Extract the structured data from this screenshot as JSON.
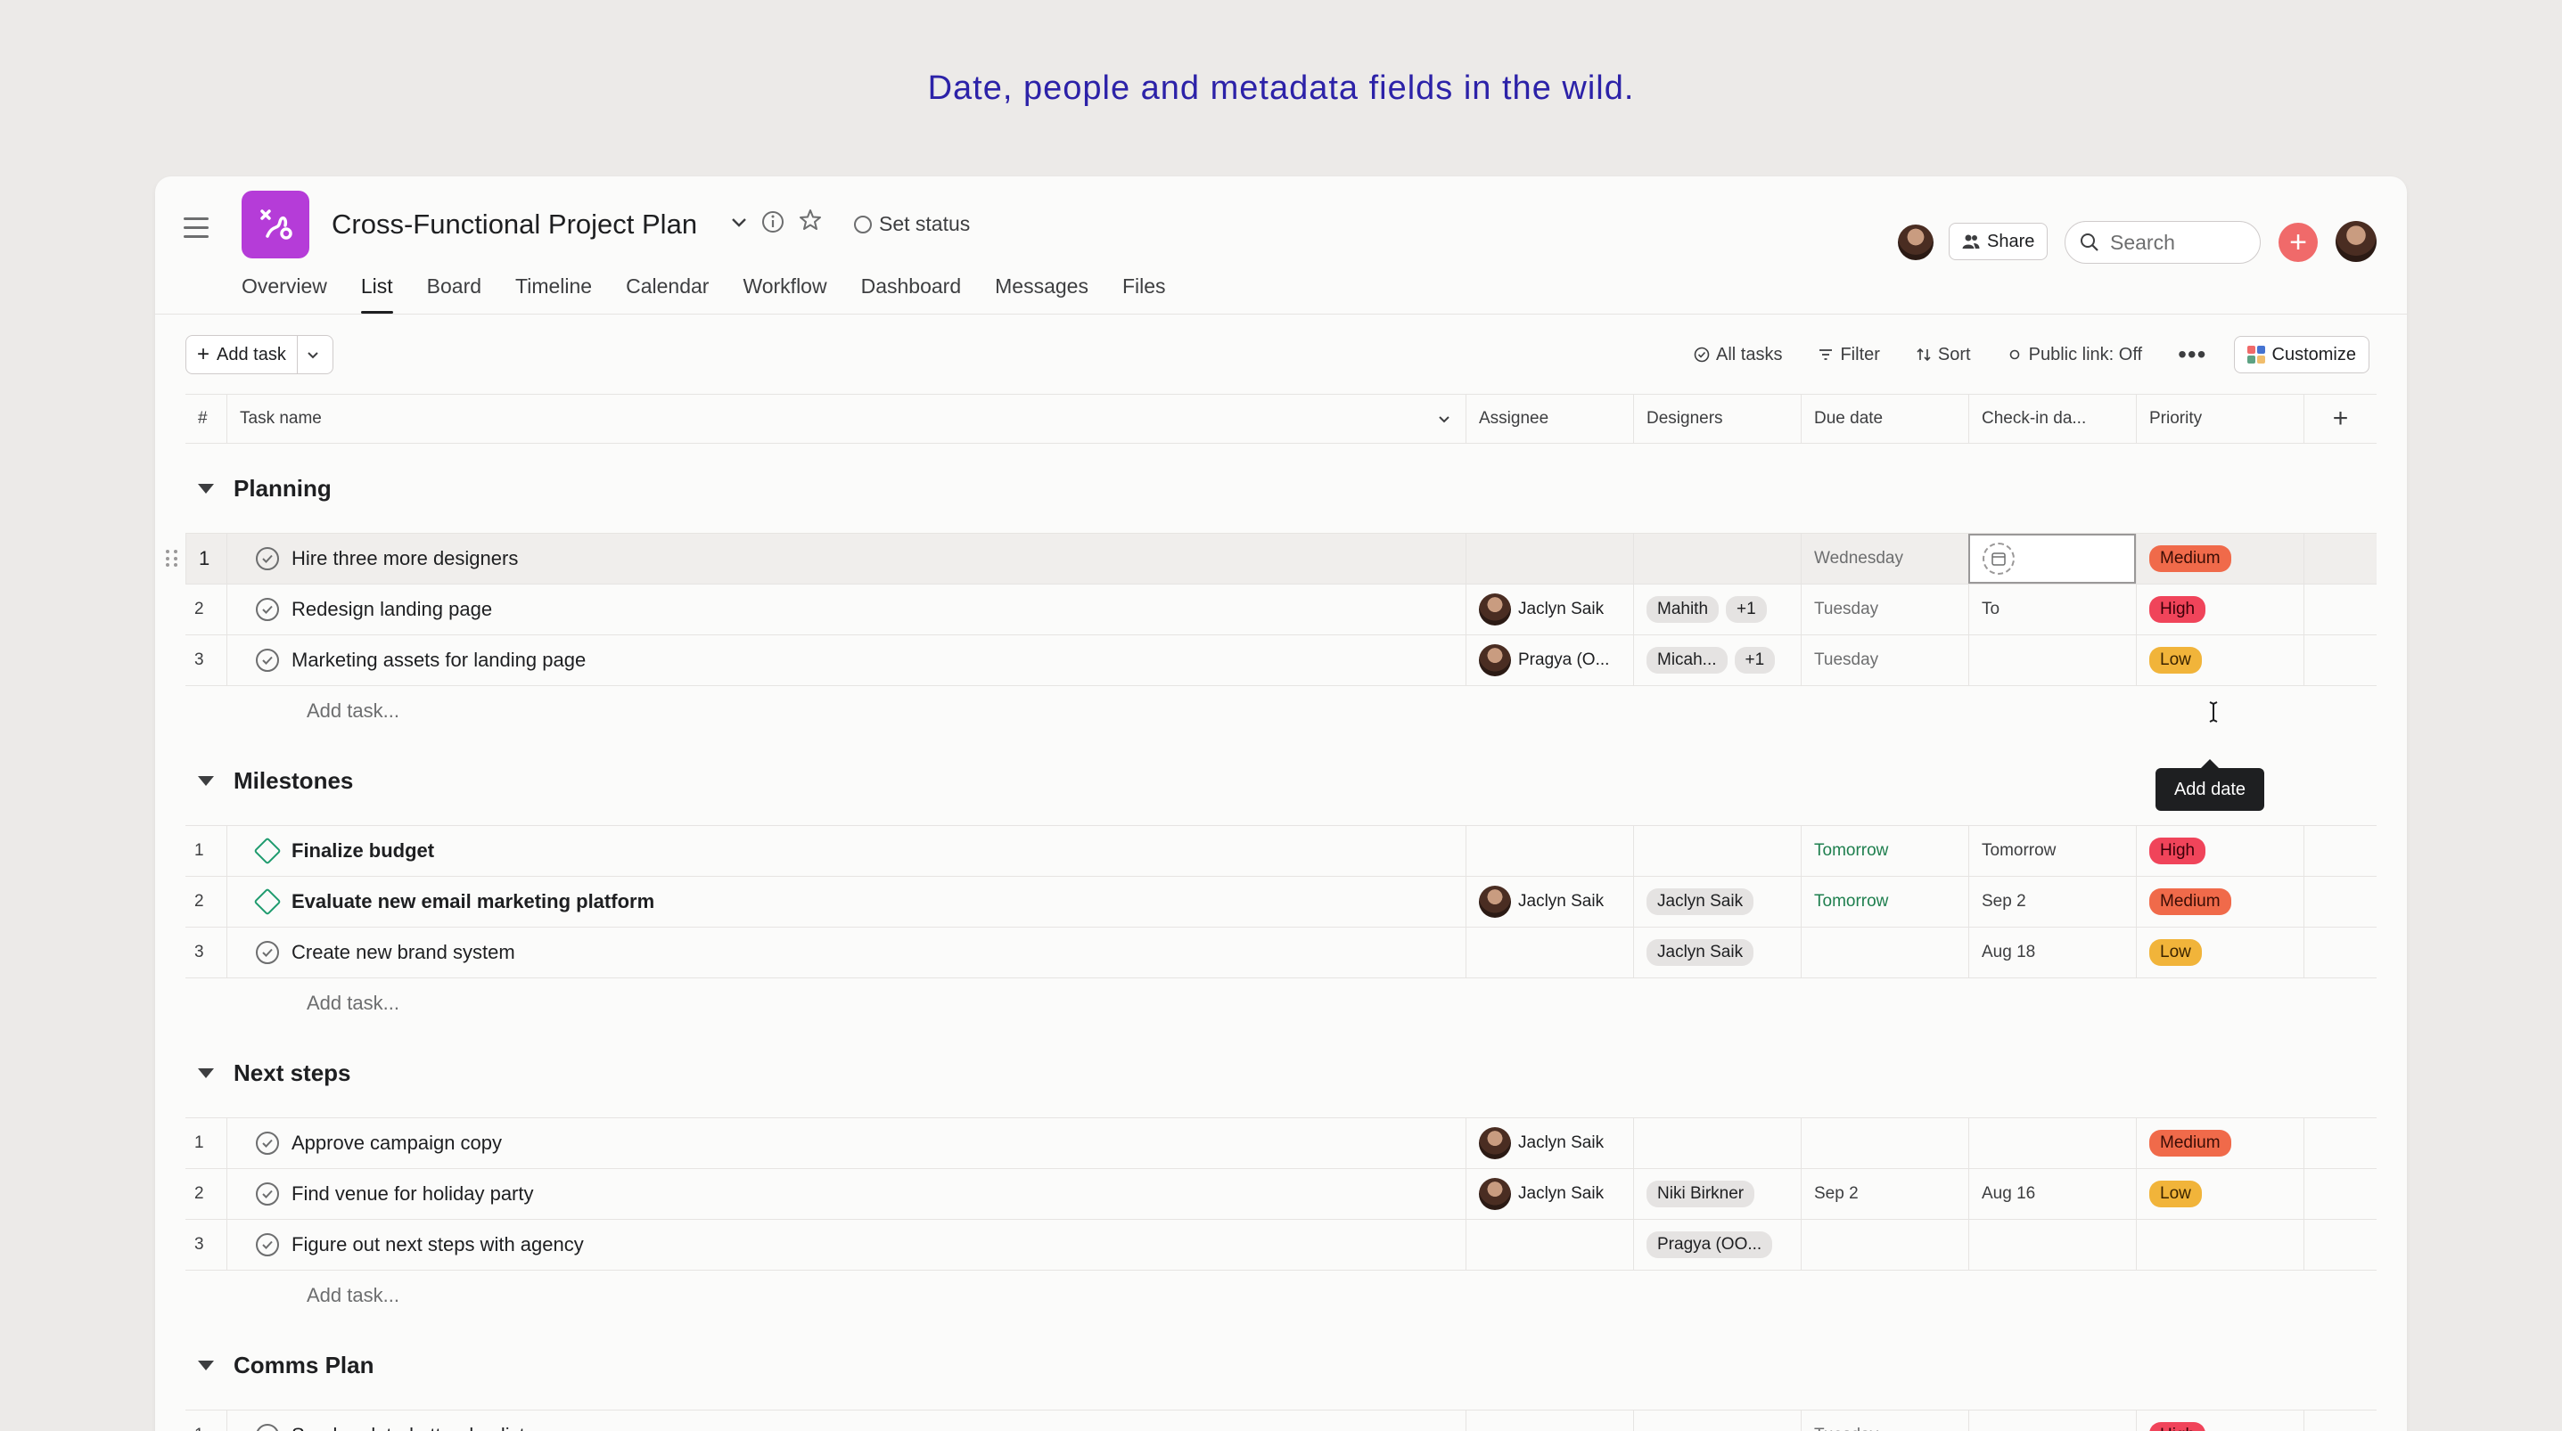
{
  "headline": "Date, people and metadata fields in the wild.",
  "project": {
    "title": "Cross-Functional Project Plan",
    "set_status": "Set status"
  },
  "tabs": [
    {
      "label": "Overview"
    },
    {
      "label": "List",
      "active": true
    },
    {
      "label": "Board"
    },
    {
      "label": "Timeline"
    },
    {
      "label": "Calendar"
    },
    {
      "label": "Workflow"
    },
    {
      "label": "Dashboard"
    },
    {
      "label": "Messages"
    },
    {
      "label": "Files"
    }
  ],
  "header": {
    "share_label": "Share",
    "search_placeholder": "Search"
  },
  "toolbar": {
    "add_task_label": "Add task",
    "all_tasks": "All tasks",
    "filter": "Filter",
    "sort": "Sort",
    "public_link": "Public link: Off",
    "customize": "Customize"
  },
  "columns": {
    "num": "#",
    "task_name": "Task name",
    "assignee": "Assignee",
    "designers": "Designers",
    "due_date": "Due date",
    "check_in": "Check-in da...",
    "priority": "Priority"
  },
  "add_task_placeholder": "Add task...",
  "tooltip": "Add date",
  "row2_checkin_partial": "To",
  "sections": [
    {
      "name": "Planning",
      "rows": [
        {
          "num": "1",
          "name": "Hire three more designers",
          "type": "task",
          "assignee": "",
          "designers": [],
          "due": "Wednesday",
          "due_style": "",
          "checkin": "",
          "priority": "Medium"
        },
        {
          "num": "2",
          "name": "Redesign landing page",
          "type": "task",
          "assignee": "Jaclyn Saik",
          "designers": [
            "Mahith",
            "+1"
          ],
          "due": "Tuesday",
          "due_style": "",
          "checkin": "",
          "priority": "High"
        },
        {
          "num": "3",
          "name": "Marketing assets for landing page",
          "type": "task",
          "assignee": "Pragya (O...",
          "designers": [
            "Micah...",
            "+1"
          ],
          "due": "Tuesday",
          "due_style": "",
          "checkin": "",
          "priority": "Low"
        }
      ]
    },
    {
      "name": "Milestones",
      "rows": [
        {
          "num": "1",
          "name": "Finalize budget",
          "type": "milestone",
          "assignee": "",
          "designers": [],
          "due": "Tomorrow",
          "due_style": "green",
          "checkin": "Tomorrow",
          "priority": "High"
        },
        {
          "num": "2",
          "name": "Evaluate new email marketing platform",
          "type": "milestone",
          "assignee": "Jaclyn Saik",
          "designers": [
            "Jaclyn Saik"
          ],
          "due": "Tomorrow",
          "due_style": "green",
          "checkin": "Sep 2",
          "priority": "Medium"
        },
        {
          "num": "3",
          "name": "Create new brand system",
          "type": "task",
          "assignee": "",
          "designers": [
            "Jaclyn Saik"
          ],
          "due": "",
          "due_style": "",
          "checkin": "Aug 18",
          "priority": "Low"
        }
      ]
    },
    {
      "name": "Next steps",
      "rows": [
        {
          "num": "1",
          "name": "Approve campaign copy",
          "type": "task",
          "assignee": "Jaclyn Saik",
          "designers": [],
          "due": "",
          "due_style": "",
          "checkin": "",
          "priority": "Medium"
        },
        {
          "num": "2",
          "name": "Find venue for holiday party",
          "type": "task",
          "assignee": "Jaclyn Saik",
          "designers": [
            "Niki Birkner"
          ],
          "due": "Sep 2",
          "due_style": "dark",
          "checkin": "Aug 16",
          "priority": "Low"
        },
        {
          "num": "3",
          "name": "Figure out next steps with agency",
          "type": "task",
          "assignee": "",
          "designers": [
            "Pragya (OO..."
          ],
          "due": "",
          "due_style": "",
          "checkin": "",
          "priority": ""
        }
      ]
    },
    {
      "name": "Comms Plan",
      "rows": [
        {
          "num": "1",
          "name": "Send updated attendee list",
          "type": "task",
          "assignee": "",
          "designers": [],
          "due": "Tuesday",
          "due_style": "",
          "checkin": "",
          "priority": "High"
        }
      ],
      "no_add_row": true
    }
  ],
  "colors": {
    "project_icon": "#b53cd8",
    "accent_red": "#f06a6a",
    "priority_medium": "#f06a4a",
    "priority_high": "#f0445a",
    "priority_low": "#f1b43a",
    "headline": "#2c22a8"
  }
}
